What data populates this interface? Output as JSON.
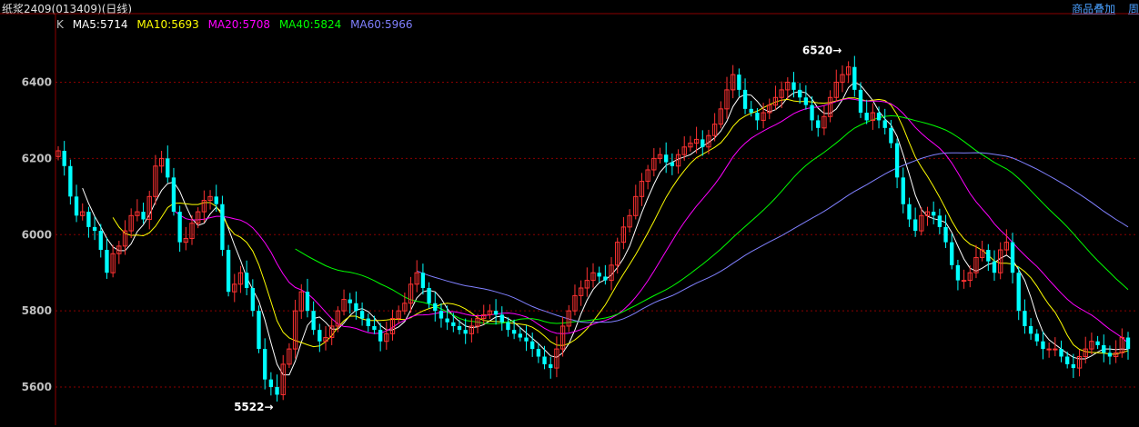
{
  "header": {
    "title": "纸浆2409(013409)(日线)",
    "overlay_label": "商品叠加",
    "period_label": "周"
  },
  "legend": {
    "k_label": "K",
    "ma5": "MA5:5714",
    "ma10": "MA10:5693",
    "ma20": "MA20:5708",
    "ma40": "MA40:5824",
    "ma60": "MA60:5966"
  },
  "colors": {
    "up": "#ff3232",
    "down": "#00ffff",
    "ma5": "#ffffff",
    "ma10": "#ffff00",
    "ma20": "#ff00ff",
    "ma40": "#00ff00",
    "ma60": "#8080ff",
    "grid": "#8b0000",
    "axis": "#c0c0c0"
  },
  "chart_data": {
    "type": "candlestick",
    "y_ticks": [
      5600,
      5800,
      6000,
      6200,
      6400
    ],
    "ylim": [
      5500,
      6580
    ],
    "annotations": [
      {
        "label": "6520",
        "value": 6520
      },
      {
        "label": "5522",
        "value": 5522
      }
    ],
    "closes": [
      6220,
      6180,
      6100,
      6050,
      6060,
      6020,
      6010,
      5960,
      5900,
      5950,
      5970,
      6010,
      6050,
      6060,
      6040,
      6100,
      6180,
      6200,
      6150,
      6060,
      5980,
      5990,
      6030,
      6060,
      6090,
      6100,
      6080,
      5960,
      5850,
      5870,
      5900,
      5860,
      5800,
      5700,
      5620,
      5600,
      5580,
      5660,
      5700,
      5800,
      5850,
      5800,
      5750,
      5720,
      5730,
      5760,
      5800,
      5830,
      5820,
      5800,
      5780,
      5760,
      5750,
      5720,
      5740,
      5780,
      5800,
      5820,
      5870,
      5900,
      5860,
      5820,
      5800,
      5780,
      5770,
      5760,
      5750,
      5740,
      5760,
      5780,
      5790,
      5800,
      5790,
      5770,
      5750,
      5740,
      5730,
      5720,
      5700,
      5680,
      5660,
      5650,
      5700,
      5760,
      5800,
      5840,
      5860,
      5880,
      5900,
      5890,
      5880,
      5920,
      5980,
      6020,
      6050,
      6100,
      6140,
      6170,
      6200,
      6210,
      6190,
      6180,
      6210,
      6230,
      6240,
      6250,
      6230,
      6260,
      6290,
      6330,
      6380,
      6420,
      6380,
      6330,
      6320,
      6300,
      6320,
      6340,
      6360,
      6380,
      6400,
      6380,
      6360,
      6340,
      6300,
      6280,
      6310,
      6360,
      6400,
      6420,
      6440,
      6380,
      6320,
      6300,
      6320,
      6300,
      6280,
      6240,
      6150,
      6080,
      6040,
      6010,
      6050,
      6060,
      6050,
      6020,
      5980,
      5920,
      5880,
      5880,
      5900,
      5940,
      5960,
      5930,
      5900,
      5960,
      5980,
      5900,
      5800,
      5760,
      5740,
      5720,
      5700,
      5700,
      5700,
      5680,
      5660,
      5650,
      5680,
      5700,
      5720,
      5710,
      5690,
      5680,
      5690,
      5730,
      5700
    ]
  }
}
